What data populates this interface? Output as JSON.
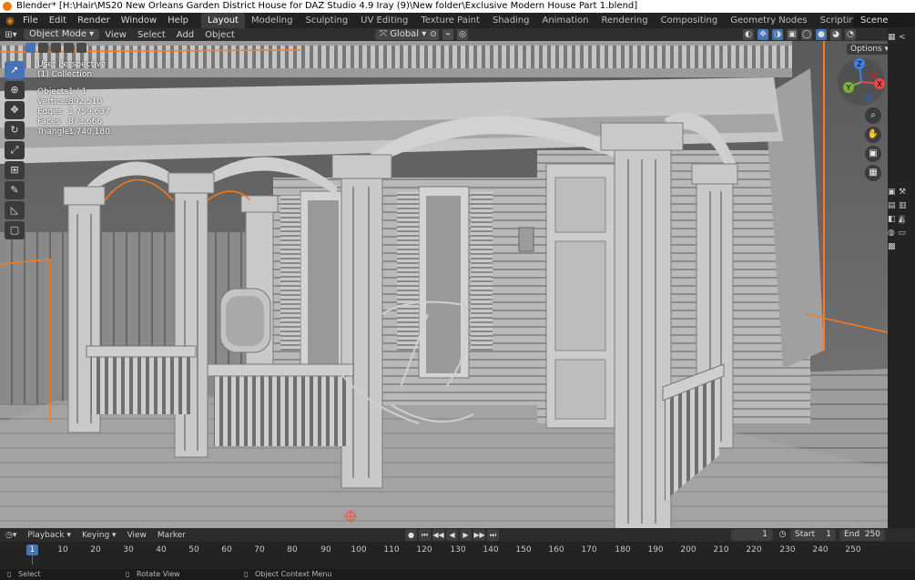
{
  "window": {
    "title": "Blender* [H:\\Hair\\MS20 New Orleans Garden District House for DAZ Studio 4.9 Iray  (9)\\New folder\\Exclusive Modern House Part 1.blend]"
  },
  "menubar": {
    "menus": [
      "File",
      "Edit",
      "Render",
      "Window",
      "Help"
    ],
    "workspaces": [
      "Layout",
      "Modeling",
      "Sculpting",
      "UV Editing",
      "Texture Paint",
      "Shading",
      "Animation",
      "Rendering",
      "Compositing",
      "Geometry Nodes",
      "Scripting"
    ],
    "active_workspace": "Layout",
    "scene": "Scene"
  },
  "viewport_header": {
    "mode": "Object Mode",
    "menus": [
      "View",
      "Select",
      "Add",
      "Object"
    ],
    "transform_orientation": "Global",
    "options": "Options"
  },
  "overlay": {
    "view_name": "User Perspective",
    "collection": "(1) Collection",
    "stats": [
      {
        "label": "Objects",
        "value": "1 / 1"
      },
      {
        "label": "Vertices",
        "value": "892,510"
      },
      {
        "label": "Edges",
        "value": "1,759,637"
      },
      {
        "label": "Faces",
        "value": "873,666"
      },
      {
        "label": "Triangles",
        "value": "1,740,180"
      }
    ]
  },
  "gizmo": {
    "x_label": "X",
    "y_label": "Y",
    "z_label": "Z",
    "x_color": "#e8454f",
    "y_color": "#7fb13a",
    "z_color": "#3f7fe8"
  },
  "timeline": {
    "menus": [
      "Playback",
      "Keying",
      "View",
      "Marker"
    ],
    "current_frame": "1",
    "start_label": "Start",
    "start": "1",
    "end_label": "End",
    "end": "250",
    "ticks": [
      "10",
      "20",
      "30",
      "40",
      "50",
      "60",
      "70",
      "80",
      "90",
      "100",
      "110",
      "120",
      "130",
      "140",
      "150",
      "160",
      "170",
      "180",
      "190",
      "200",
      "210",
      "220",
      "230",
      "240",
      "250"
    ],
    "cursor_frame": "1"
  },
  "statusbar": {
    "select": "Select",
    "rotate": "Rotate View",
    "context": "Object Context Menu"
  },
  "colors": {
    "accent": "#4772b3",
    "selection_outline": "#ff7a1a",
    "blender_orange": "#e87d0d"
  }
}
